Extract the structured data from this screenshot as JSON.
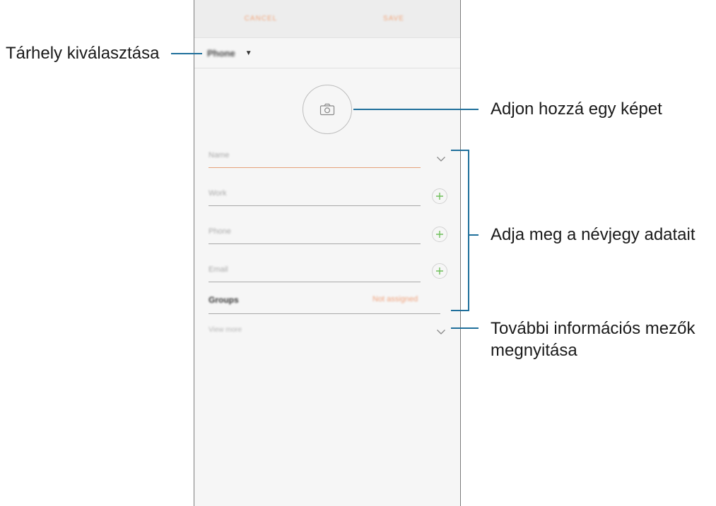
{
  "toolbar": {
    "cancel_label": "CANCEL",
    "save_label": "SAVE"
  },
  "storage": {
    "label": "Phone"
  },
  "fields": [
    {
      "placeholder": "Name"
    },
    {
      "placeholder": "Work"
    },
    {
      "placeholder": "Phone"
    },
    {
      "placeholder": "Email"
    }
  ],
  "groups": {
    "label": "Groups",
    "value": "Not assigned"
  },
  "view_more": {
    "label": "View more"
  },
  "annotations": {
    "storage": "Tárhely kiválasztása",
    "photo": "Adjon hozzá egy képet",
    "details": "Adja meg a névjegy adatait",
    "more_line1": "További információs mezők",
    "more_line2": "megnyitása"
  },
  "colors": {
    "accent": "#f0a27c",
    "add_plus": "#6fbf5a",
    "callout_line": "#1f6f9b"
  }
}
